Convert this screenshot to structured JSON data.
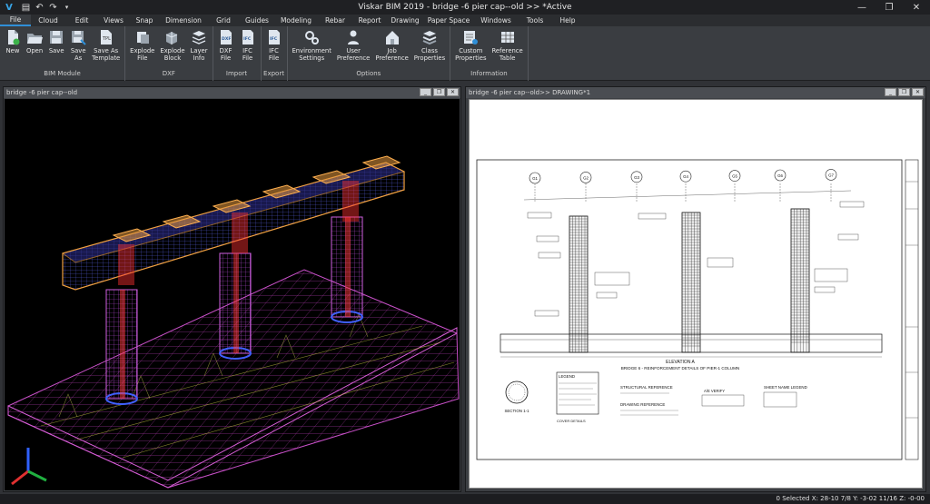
{
  "title": "Viskar BIM 2019 - bridge -6 pier cap--old >> *Active",
  "menu": [
    "File",
    "Cloud",
    "Edit",
    "Views",
    "Snap",
    "Dimension",
    "Grid",
    "Guides",
    "Modeling",
    "Rebar",
    "Report",
    "Drawing",
    "Paper Space",
    "Windows",
    "Tools",
    "Help"
  ],
  "ribbon": {
    "groups": [
      {
        "label": "BIM Module",
        "buttons": [
          {
            "l1": "New",
            "l2": "",
            "icon": "new-file-icon"
          },
          {
            "l1": "Open",
            "l2": "",
            "icon": "open-folder-icon"
          },
          {
            "l1": "Save",
            "l2": "",
            "icon": "save-icon"
          },
          {
            "l1": "Save",
            "l2": "As",
            "icon": "save-as-icon"
          },
          {
            "l1": "Save As",
            "l2": "Template",
            "icon": "save-template-icon"
          }
        ]
      },
      {
        "label": "DXF",
        "buttons": [
          {
            "l1": "Explode",
            "l2": "File",
            "icon": "explode-file-icon"
          },
          {
            "l1": "Explode",
            "l2": "Block",
            "icon": "explode-block-icon"
          },
          {
            "l1": "Layer",
            "l2": "Info",
            "icon": "layer-info-icon"
          }
        ]
      },
      {
        "label": "Import",
        "buttons": [
          {
            "l1": "DXF",
            "l2": "File",
            "icon": "dxf-file-icon",
            "tag": "DXF"
          },
          {
            "l1": "IFC",
            "l2": "File",
            "icon": "ifc-file-icon",
            "tag": "IFC"
          }
        ]
      },
      {
        "label": "Export",
        "buttons": [
          {
            "l1": "IFC",
            "l2": "File",
            "icon": "ifc-export-icon",
            "tag": "IFC"
          }
        ]
      },
      {
        "label": "Options",
        "buttons": [
          {
            "l1": "Environment",
            "l2": "Settings",
            "icon": "gears-icon"
          },
          {
            "l1": "User",
            "l2": "Preference",
            "icon": "user-icon"
          },
          {
            "l1": "Job",
            "l2": "Preference",
            "icon": "house-icon"
          },
          {
            "l1": "Class",
            "l2": "Properties",
            "icon": "layers-icon"
          }
        ]
      },
      {
        "label": "Information",
        "buttons": [
          {
            "l1": "Custom",
            "l2": "Properties",
            "icon": "custom-properties-icon"
          },
          {
            "l1": "Reference",
            "l2": "Table",
            "icon": "table-icon"
          }
        ]
      }
    ]
  },
  "left_panel": {
    "title": "bridge -6 pier cap--old"
  },
  "right_panel": {
    "title": "bridge -6 pier cap--old>> DRAWING*1"
  },
  "drawing": {
    "elevation": "ELEVATION A",
    "subtitle": "BRIDGE 6 - REINFORCEMENT DETAILS OF PIER-1 COLUMN",
    "legend": "LEGEND",
    "section": "SECTION 1-1",
    "cover": "COVER DETAILS",
    "structural": "STRUCTURAL REFERENCE",
    "drawing_ref": "DRAWING REFERENCE",
    "verify": "A/E VERIFY",
    "sheet_legend": "SHEET NAME LEGEND",
    "grid_labels": [
      "G1",
      "G2",
      "G3",
      "G4",
      "G5",
      "G6",
      "G7"
    ]
  },
  "status": "0 Selected X: 28-10 7/8  Y: -3-02 11/16  Z: -0-00",
  "colors": {
    "accent": "#2f8fd8",
    "ribbon": "#3a3d41",
    "rebar_magenta": "#c850c8",
    "cap_orange": "#f0a040",
    "rebar_blue": "#4060ff"
  }
}
